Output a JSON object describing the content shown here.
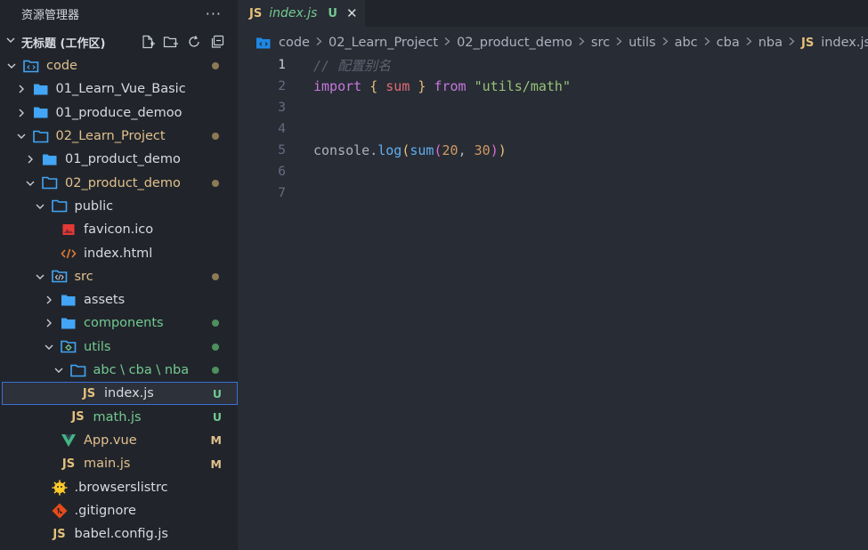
{
  "sidebar": {
    "title": "资源管理器",
    "more_label": "···",
    "workspace": {
      "title": "无标题 (工作区)"
    },
    "tree": [
      {
        "label": "code",
        "icon": "folder-src-open-icon",
        "chevron": "down",
        "indent": 0,
        "color": "olive",
        "status": "dot"
      },
      {
        "label": "01_Learn_Vue_Basic",
        "icon": "folder-icon",
        "chevron": "right",
        "indent": 1,
        "color": "default"
      },
      {
        "label": "01_produce_demoo",
        "icon": "folder-icon",
        "chevron": "right",
        "indent": 1,
        "color": "default"
      },
      {
        "label": "02_Learn_Project",
        "icon": "folder-open-icon",
        "chevron": "down",
        "indent": 1,
        "color": "olive",
        "status": "dot"
      },
      {
        "label": "01_product_demo",
        "icon": "folder-icon",
        "chevron": "right",
        "indent": 2,
        "color": "default"
      },
      {
        "label": "02_product_demo",
        "icon": "folder-open-icon",
        "chevron": "down",
        "indent": 2,
        "color": "olive",
        "status": "dot"
      },
      {
        "label": "public",
        "icon": "folder-open-icon",
        "chevron": "down",
        "indent": 3,
        "color": "default"
      },
      {
        "label": "favicon.ico",
        "icon": "image-file-icon",
        "chevron": "none",
        "indent": 4,
        "color": "default"
      },
      {
        "label": "index.html",
        "icon": "html-file-icon",
        "chevron": "none",
        "indent": 4,
        "color": "default"
      },
      {
        "label": "src",
        "icon": "folder-src-icon",
        "chevron": "down",
        "indent": 3,
        "color": "olive",
        "status": "dot"
      },
      {
        "label": "assets",
        "icon": "folder-icon",
        "chevron": "right",
        "indent": 4,
        "color": "default"
      },
      {
        "label": "components",
        "icon": "folder-icon",
        "chevron": "right",
        "indent": 4,
        "color": "green",
        "status": "dot-green"
      },
      {
        "label": "utils",
        "icon": "folder-utils-icon",
        "chevron": "down",
        "indent": 4,
        "color": "green",
        "status": "dot-green"
      },
      {
        "label": "abc \\ cba \\ nba",
        "icon": "folder-open-icon",
        "chevron": "down",
        "indent": 5,
        "color": "green",
        "status": "dot-green"
      },
      {
        "label": "index.js",
        "icon": "js-file-icon",
        "chevron": "none",
        "indent": 6,
        "color": "default",
        "status": "U",
        "selected": true
      },
      {
        "label": "math.js",
        "icon": "js-file-icon",
        "chevron": "none",
        "indent": 5,
        "color": "green",
        "status": "U"
      },
      {
        "label": "App.vue",
        "icon": "vue-file-icon",
        "chevron": "none",
        "indent": 4,
        "color": "olive",
        "status": "M"
      },
      {
        "label": "main.js",
        "icon": "js-file-icon",
        "chevron": "none",
        "indent": 4,
        "color": "olive",
        "status": "M"
      },
      {
        "label": ".browserslistrc",
        "icon": "browserslist-file-icon",
        "chevron": "none",
        "indent": 3,
        "color": "default"
      },
      {
        "label": ".gitignore",
        "icon": "git-file-icon",
        "chevron": "none",
        "indent": 3,
        "color": "default"
      },
      {
        "label": "babel.config.js",
        "icon": "js-file-icon",
        "chevron": "none",
        "indent": 3,
        "color": "default"
      }
    ]
  },
  "editor": {
    "tab": {
      "icon_label": "JS",
      "name": "index.js",
      "status": "U",
      "close": "✕"
    },
    "breadcrumb": [
      "code",
      "02_Learn_Project",
      "02_product_demo",
      "src",
      "utils",
      "abc",
      "cba",
      "nba",
      "index.js"
    ],
    "breadcrumb_file_icon": "JS",
    "lines": [
      {
        "n": "1",
        "tokens": [
          {
            "t": "// 配置别名",
            "k": "comment"
          }
        ]
      },
      {
        "n": "2",
        "tokens": [
          {
            "t": "import",
            "k": "kw"
          },
          {
            "t": " ",
            "k": "plain"
          },
          {
            "t": "{",
            "k": "brace"
          },
          {
            "t": " ",
            "k": "plain"
          },
          {
            "t": "sum",
            "k": "var"
          },
          {
            "t": " ",
            "k": "plain"
          },
          {
            "t": "}",
            "k": "brace"
          },
          {
            "t": " ",
            "k": "plain"
          },
          {
            "t": "from",
            "k": "kw"
          },
          {
            "t": " ",
            "k": "plain"
          },
          {
            "t": "\"utils/math\"",
            "k": "str"
          }
        ]
      },
      {
        "n": "3",
        "tokens": []
      },
      {
        "n": "4",
        "tokens": []
      },
      {
        "n": "5",
        "tokens": [
          {
            "t": "console",
            "k": "plain"
          },
          {
            "t": ".",
            "k": "plain"
          },
          {
            "t": "log",
            "k": "fn"
          },
          {
            "t": "(",
            "k": "paren"
          },
          {
            "t": "sum",
            "k": "fn"
          },
          {
            "t": "(",
            "k": "paren2"
          },
          {
            "t": "20",
            "k": "num"
          },
          {
            "t": ", ",
            "k": "plain"
          },
          {
            "t": "30",
            "k": "num"
          },
          {
            "t": ")",
            "k": "paren2"
          },
          {
            "t": ")",
            "k": "paren"
          }
        ]
      },
      {
        "n": "6",
        "tokens": []
      },
      {
        "n": "7",
        "tokens": []
      }
    ],
    "active_line": "1"
  },
  "colors": {
    "sidebar_bg": "#21252b",
    "editor_bg": "#282c34",
    "folder": "#42a5f5",
    "untracked": "#73c991",
    "modified": "#e2c08d",
    "selection_border": "#3d6fd6"
  }
}
